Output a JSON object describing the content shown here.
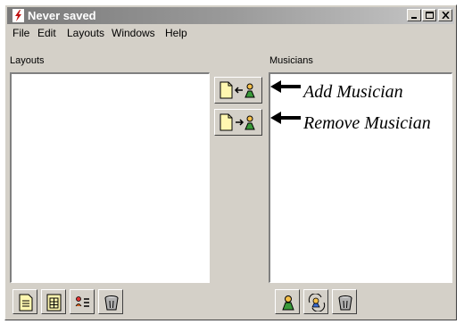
{
  "window": {
    "title": "Never saved",
    "app_icon": "lightning-icon",
    "controls": [
      "minimize-icon",
      "maximize-icon",
      "close-icon"
    ]
  },
  "menu": {
    "items": [
      "File",
      "Edit",
      "Layouts",
      "Windows",
      "Help"
    ]
  },
  "layouts_pane": {
    "label": "Layouts",
    "toolbar": [
      "new-layout-icon",
      "layout-grid-icon",
      "layout-properties-icon",
      "trash-icon"
    ]
  },
  "transfer_buttons": {
    "add": "add-musician-icon",
    "remove": "remove-musician-icon"
  },
  "musicians_pane": {
    "label": "Musicians",
    "toolbar": [
      "musician-icon",
      "musician-refresh-icon",
      "trash-icon"
    ]
  },
  "annotations": {
    "add": "Add Musician",
    "remove": "Remove Musician"
  }
}
